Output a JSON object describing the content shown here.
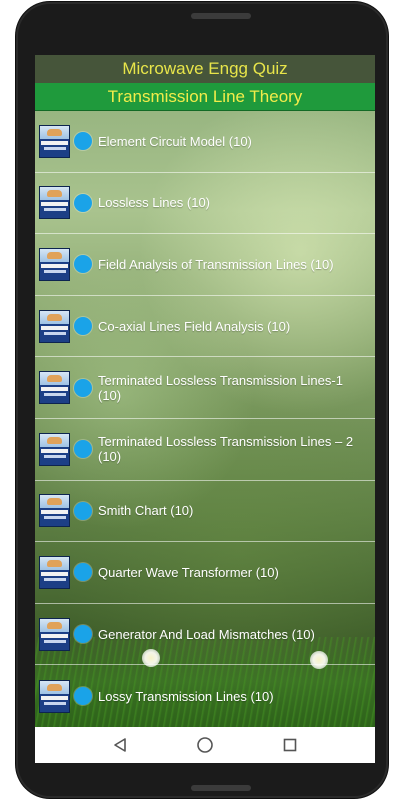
{
  "app": {
    "name": "Microwave Engg Quiz",
    "section_title": "Transmission Line Theory"
  },
  "thumbnail": {
    "line1": "MICROWAVE",
    "line2": "Engineering"
  },
  "topics": [
    {
      "label": "Element Circuit Model  (10)"
    },
    {
      "label": "Lossless Lines (10)"
    },
    {
      "label": "Field Analysis of Transmission Lines (10)"
    },
    {
      "label": "Co-axial Lines Field Analysis (10)"
    },
    {
      "label": "Terminated Lossless Transmission Lines-1 (10)"
    },
    {
      "label": "Terminated Lossless Transmission Lines – 2 (10)"
    },
    {
      "label": "Smith Chart (10)"
    },
    {
      "label": "Quarter Wave Transformer (10)"
    },
    {
      "label": "Generator And Load Mismatches (10)"
    },
    {
      "label": "Lossy Transmission Lines (10)"
    }
  ],
  "colors": {
    "app_bar": "#46553a",
    "title_bar": "#1f9a3c",
    "title_text": "#f2ec4a",
    "dot": "#1aa3e8"
  },
  "icons": {
    "back": "back-triangle-icon",
    "home": "home-circle-icon",
    "recents": "recents-square-icon"
  }
}
